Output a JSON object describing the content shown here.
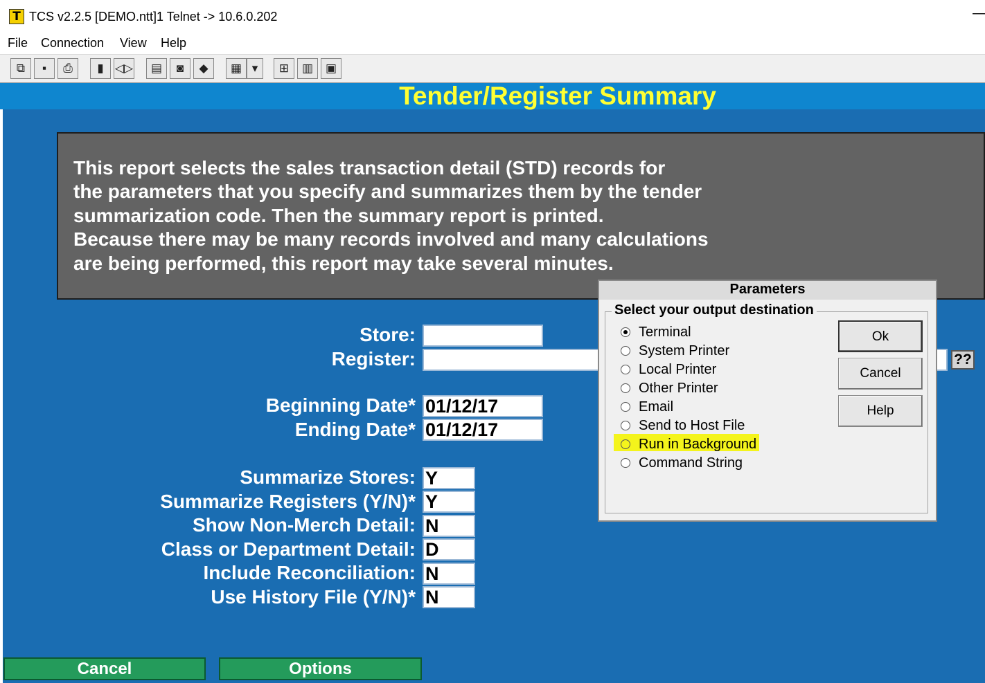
{
  "window": {
    "title": "TCS v2.2.5 [DEMO.ntt]1 Telnet -> 10.6.0.202",
    "minimize_glyph": "—"
  },
  "menu": {
    "items": [
      "File",
      "Connection",
      "View",
      "Help"
    ]
  },
  "toolbar": {
    "icons": [
      "copy-icon",
      "save-icon",
      "print-icon",
      "lock-icon",
      "sound-icon",
      "properties-icon",
      "terminal-icon",
      "book-icon",
      "document-icon",
      "dropdown-arrow-icon",
      "network-icon",
      "chart-icon",
      "calculator-icon"
    ]
  },
  "report": {
    "title": "Tender/Register Summary",
    "description": [
      "This report selects the sales transaction detail (STD) records for",
      "the parameters that you specify and summarizes them by the tender",
      "summarization code. Then the summary report is printed.",
      "Because there may be many records involved and many calculations",
      "are being performed, this report may take several minutes."
    ]
  },
  "form": {
    "store_label": "Store:",
    "store_value": "",
    "register_label": "Register:",
    "register_value": "",
    "lookup_label": "??",
    "begin_label": "Beginning Date*",
    "begin_value": "01/12/17",
    "end_label": "Ending Date*",
    "end_value": "01/12/17",
    "summarize_stores_label": "Summarize Stores:",
    "summarize_stores_value": "Y",
    "summarize_registers_label": "Summarize Registers (Y/N)*",
    "summarize_registers_value": "Y",
    "non_merch_label": "Show Non-Merch Detail:",
    "non_merch_value": "N",
    "class_dept_label": "Class or Department Detail:",
    "class_dept_value": "D",
    "reconciliation_label": "Include Reconciliation:",
    "reconciliation_value": "N",
    "history_label": "Use History File (Y/N)*",
    "history_value": "N"
  },
  "bottom_buttons": {
    "cancel": "Cancel",
    "options": "Options"
  },
  "dialog": {
    "title": "Parameters",
    "group_label": "Select your output destination",
    "options": [
      "Terminal",
      "System Printer",
      "Local Printer",
      "Other Printer",
      "Email",
      "Send to Host File",
      "Run in Background",
      "Command String"
    ],
    "selected": "Terminal",
    "highlighted": "Run in Background",
    "highlight_color": "#f4f41c",
    "ok": "Ok",
    "cancel": "Cancel",
    "help": "Help"
  },
  "colors": {
    "screen_bg": "#1a6db2",
    "title_yellow": "#ffff33",
    "description_bg": "#636363",
    "button_green": "#249b5b"
  }
}
